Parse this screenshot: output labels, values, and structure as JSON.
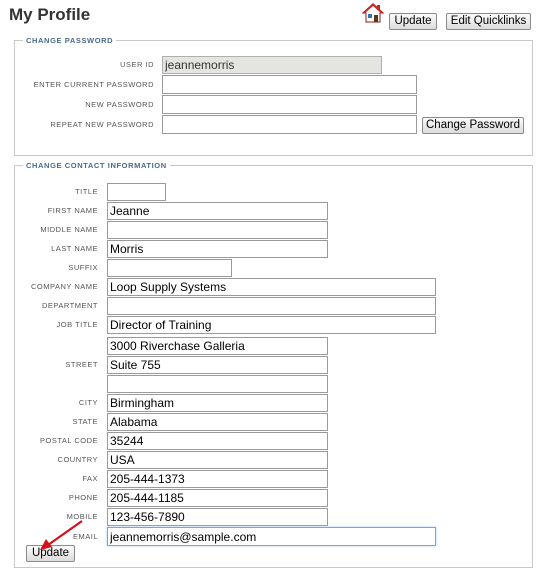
{
  "page": {
    "title": "My Profile"
  },
  "header": {
    "home_icon": "home-icon",
    "update_label": "Update",
    "quicklinks_label": "Edit Quicklinks"
  },
  "change_password": {
    "legend": "CHANGE PASSWORD",
    "user_id_label": "USER ID",
    "user_id_value": "jeannemorris",
    "current_password_label": "ENTER CURRENT PASSWORD",
    "current_password_value": "",
    "new_password_label": "NEW PASSWORD",
    "new_password_value": "",
    "repeat_password_label": "REPEAT NEW PASSWORD",
    "repeat_password_value": "",
    "change_button": "Change Password"
  },
  "contact": {
    "legend": "CHANGE CONTACT INFORMATION",
    "labels": {
      "title": "TITLE",
      "first_name": "FIRST NAME",
      "middle_name": "MIDDLE NAME",
      "last_name": "LAST NAME",
      "suffix": "SUFFIX",
      "company": "COMPANY NAME",
      "department": "DEPARTMENT",
      "job_title": "JOB TITLE",
      "street": "STREET",
      "city": "CITY",
      "state": "STATE",
      "postal_code": "POSTAL CODE",
      "country": "COUNTRY",
      "fax": "FAX",
      "phone": "PHONE",
      "mobile": "MOBILE",
      "email": "EMAIL"
    },
    "values": {
      "title": "",
      "first_name": "Jeanne",
      "middle_name": "",
      "last_name": "Morris",
      "suffix": "",
      "company": "Loop Supply Systems",
      "department": "",
      "job_title": "Director of Training",
      "street1": "3000 Riverchase Galleria",
      "street2": "Suite 755",
      "street3": "",
      "city": "Birmingham",
      "state": "Alabama",
      "postal_code": "35244",
      "country": "USA",
      "fax": "205-444-1373",
      "phone": "205-444-1185",
      "mobile": "123-456-7890",
      "email": "jeannemorris@sample.com"
    },
    "update_button": "Update"
  },
  "colors": {
    "legend": "#4a6a8a",
    "arrow": "#d0121b",
    "focus": "#7aa6d8"
  }
}
